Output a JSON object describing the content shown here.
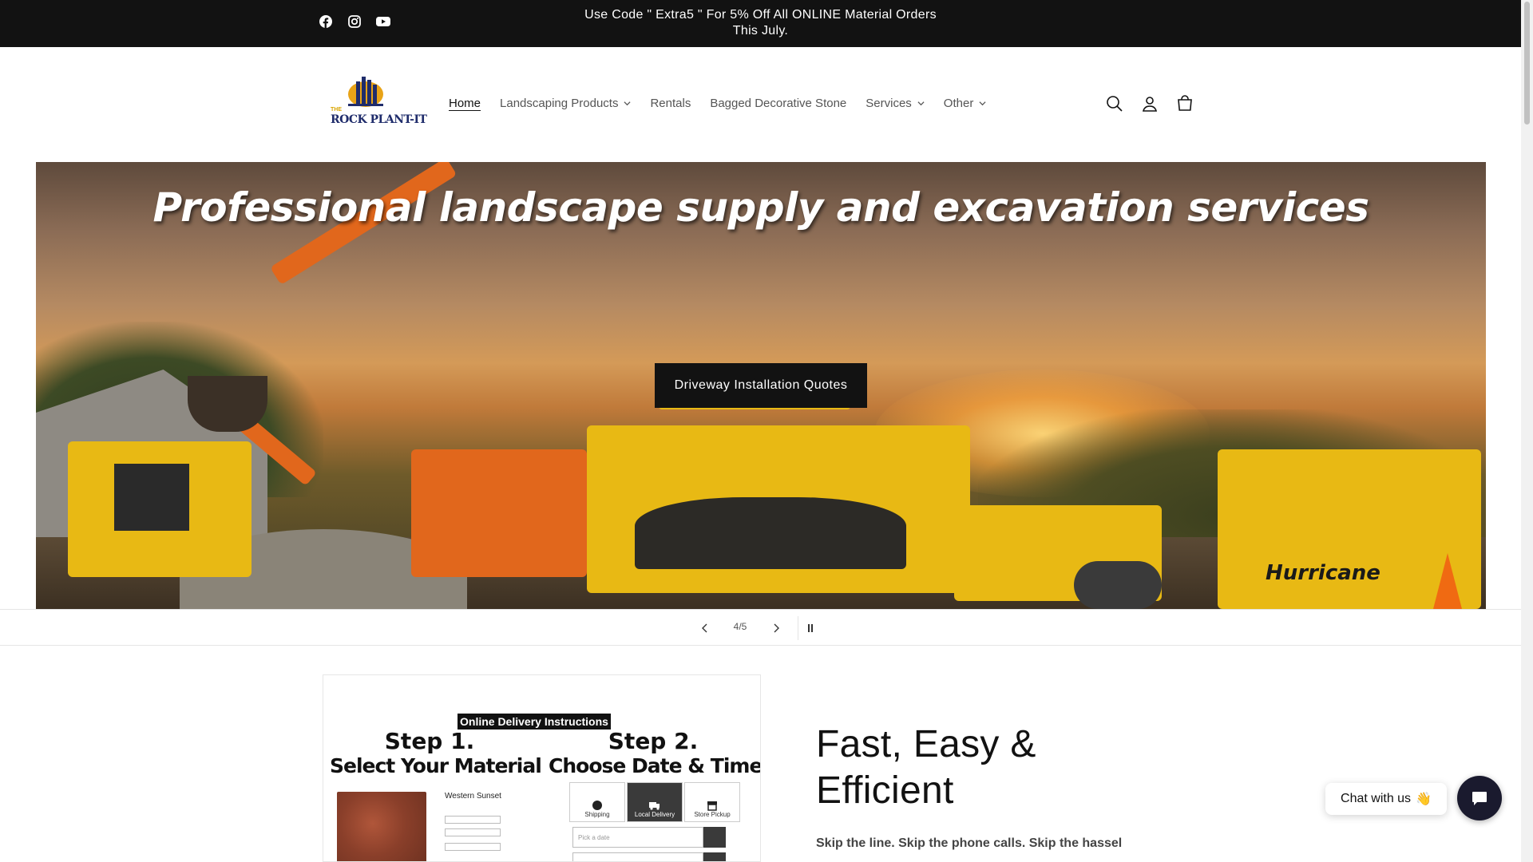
{
  "announcement": {
    "line1": "Use Code \" Extra5 \" For 5% Off All ONLINE Material Orders",
    "line2": "This July."
  },
  "social": [
    "facebook-icon",
    "instagram-icon",
    "youtube-icon"
  ],
  "logo": {
    "the": "THE",
    "name": "ROCK PLANT-IT"
  },
  "nav": [
    {
      "label": "Home",
      "active": true
    },
    {
      "label": "Landscaping Products",
      "dropdown": true
    },
    {
      "label": "Rentals"
    },
    {
      "label": "Bagged Decorative Stone"
    },
    {
      "label": "Services",
      "dropdown": true
    },
    {
      "label": "Other",
      "dropdown": true
    }
  ],
  "header_icons": [
    "search-icon",
    "account-icon",
    "cart-icon"
  ],
  "hero": {
    "title": "Professional landscape supply and excavation services",
    "button": "Driveway Installation Quotes",
    "brand_mark": "Hurricane"
  },
  "slider": {
    "counter": "4/5"
  },
  "info_card": {
    "banner": "Online Delivery Instructions",
    "step1_num": "Step 1.",
    "step1_text": "Select Your Material",
    "step2_num": "Step 2.",
    "step2_text": "Choose Date & Time",
    "product_name": "Western Sunset",
    "options": [
      "Shipping",
      "Local Delivery",
      "Store Pickup"
    ],
    "date_placeholder": "Pick a date"
  },
  "content": {
    "title_line1": "Fast, Easy &",
    "title_line2": "Efficient",
    "subtitle": "Skip the line. Skip the phone calls. Skip the hassel"
  },
  "chat": {
    "label": "Chat with us",
    "emoji": "👋"
  },
  "colors": {
    "dark": "#121212",
    "accent": "#1a1a2e",
    "logo_blue": "#1f2c6b",
    "logo_gold": "#d9a400"
  }
}
